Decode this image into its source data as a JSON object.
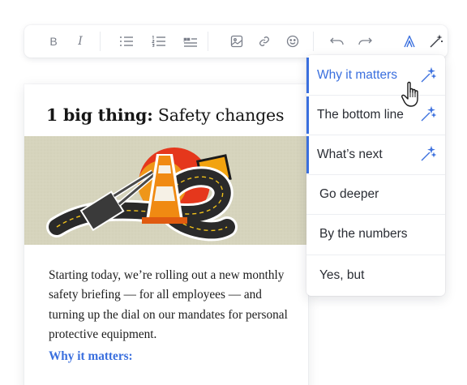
{
  "toolbar": {
    "items": [
      {
        "name": "bold-button",
        "icon": "bold-icon",
        "glyph": "B"
      },
      {
        "name": "italic-button",
        "icon": "italic-icon",
        "glyph": "I"
      },
      {
        "name": "bullet-list-button",
        "icon": "bullet-list-icon"
      },
      {
        "name": "numbered-list-button",
        "icon": "numbered-list-icon"
      },
      {
        "name": "quote-button",
        "icon": "quote-icon"
      },
      {
        "name": "image-button",
        "icon": "image-icon"
      },
      {
        "name": "link-button",
        "icon": "link-icon"
      },
      {
        "name": "emoji-button",
        "icon": "emoji-icon"
      },
      {
        "name": "undo-button",
        "icon": "undo-icon"
      },
      {
        "name": "redo-button",
        "icon": "redo-icon"
      },
      {
        "name": "brand-button",
        "icon": "brand-logo-icon"
      },
      {
        "name": "ai-wand-button",
        "icon": "magic-wand-icon"
      }
    ]
  },
  "card": {
    "title_bold": "1 big thing:",
    "title_rest": " Safety changes",
    "image": "traffic-cone-collage",
    "body": "Starting today, we’re rolling out a new monthly safety briefing — for all employees — and turning up the dial on our mandates for personal protective equipment.",
    "subhead": "Why it matters:"
  },
  "menu": {
    "items": [
      {
        "label": "Why it matters",
        "active": true,
        "highlighted": true,
        "wand": true
      },
      {
        "label": "The bottom line",
        "active": false,
        "highlighted": true,
        "wand": true
      },
      {
        "label": "What’s next",
        "active": false,
        "highlighted": true,
        "wand": true
      },
      {
        "label": "Go deeper",
        "active": false,
        "highlighted": false,
        "wand": false
      },
      {
        "label": "By the numbers",
        "active": false,
        "highlighted": false,
        "wand": false
      },
      {
        "label": "Yes, but",
        "active": false,
        "highlighted": false,
        "wand": false
      }
    ]
  },
  "colors": {
    "accent": "#3a6fde",
    "icon_gray": "#7a7f8a",
    "image_bg": "#d6d4bd",
    "cone_orange": "#f08a12",
    "sun_red": "#e5371c"
  },
  "cursor": "hand-pointer-icon"
}
